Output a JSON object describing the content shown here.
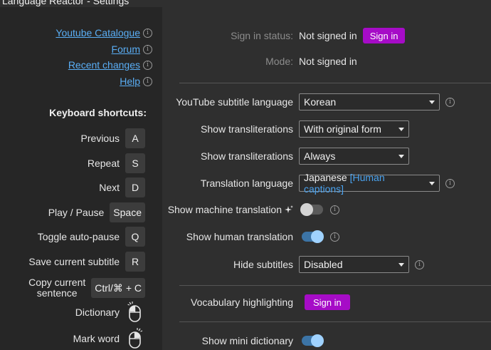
{
  "window": {
    "title": "Language Reactor - Settings"
  },
  "sidebar": {
    "links": [
      {
        "label": "Youtube Catalogue"
      },
      {
        "label": "Forum"
      },
      {
        "label": "Recent changes"
      },
      {
        "label": "Help"
      }
    ],
    "shortcuts_title": "Keyboard shortcuts:",
    "shortcuts": [
      {
        "label": "Previous",
        "key": "A"
      },
      {
        "label": "Repeat",
        "key": "S"
      },
      {
        "label": "Next",
        "key": "D"
      },
      {
        "label": "Play / Pause",
        "key": "Space"
      },
      {
        "label": "Toggle auto-pause",
        "key": "Q"
      },
      {
        "label": "Save current subtitle",
        "key": "R"
      },
      {
        "label_line1": "Copy current",
        "label_line2": "sentence",
        "key": "Ctrl/⌘ + C"
      },
      {
        "label": "Dictionary",
        "key_icon": "mouse-left-click-icon"
      },
      {
        "label": "Mark word",
        "key_icon": "mouse-right-click-icon"
      }
    ]
  },
  "main": {
    "sign_in_status_label": "Sign in status:",
    "sign_in_status_value": "Not signed in",
    "sign_in_button": "Sign in",
    "mode_label": "Mode:",
    "mode_value": "Not signed in",
    "youtube_sub_lang_label": "YouTube subtitle language",
    "youtube_sub_lang_value": "Korean",
    "translit1_label": "Show transliterations",
    "translit1_value": "With original form",
    "translit2_label": "Show transliterations",
    "translit2_value": "Always",
    "translation_lang_label": "Translation language",
    "translation_lang_value": "Japanese",
    "translation_lang_tag": "[Human captions]",
    "machine_translation_label": "Show machine translation",
    "machine_translation_on": false,
    "human_translation_label": "Show human translation",
    "human_translation_on": true,
    "hide_subtitles_label": "Hide subtitles",
    "hide_subtitles_value": "Disabled",
    "vocab_label": "Vocabulary highlighting",
    "vocab_button": "Sign in",
    "mini_dict_label": "Show mini dictionary",
    "mini_dict_on": true
  },
  "colors": {
    "accent": "#a60cc7",
    "link": "#5aaef5",
    "toggle_on": "#9fd2ff"
  }
}
